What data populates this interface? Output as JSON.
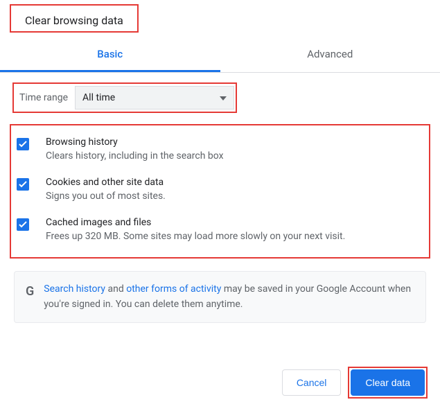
{
  "title": "Clear browsing data",
  "tabs": {
    "basic": "Basic",
    "advanced": "Advanced"
  },
  "timerange": {
    "label": "Time range",
    "value": "All time"
  },
  "options": [
    {
      "title": "Browsing history",
      "sub": "Clears history, including in the search box"
    },
    {
      "title": "Cookies and other site data",
      "sub": "Signs you out of most sites."
    },
    {
      "title": "Cached images and files",
      "sub": "Frees up 320 MB. Some sites may load more slowly on your next visit."
    }
  ],
  "info": {
    "link1": "Search history",
    "text1": " and ",
    "link2": "other forms of activity",
    "text2": " may be saved in your Google Account when you're signed in. You can delete them anytime."
  },
  "buttons": {
    "cancel": "Cancel",
    "clear": "Clear data"
  }
}
